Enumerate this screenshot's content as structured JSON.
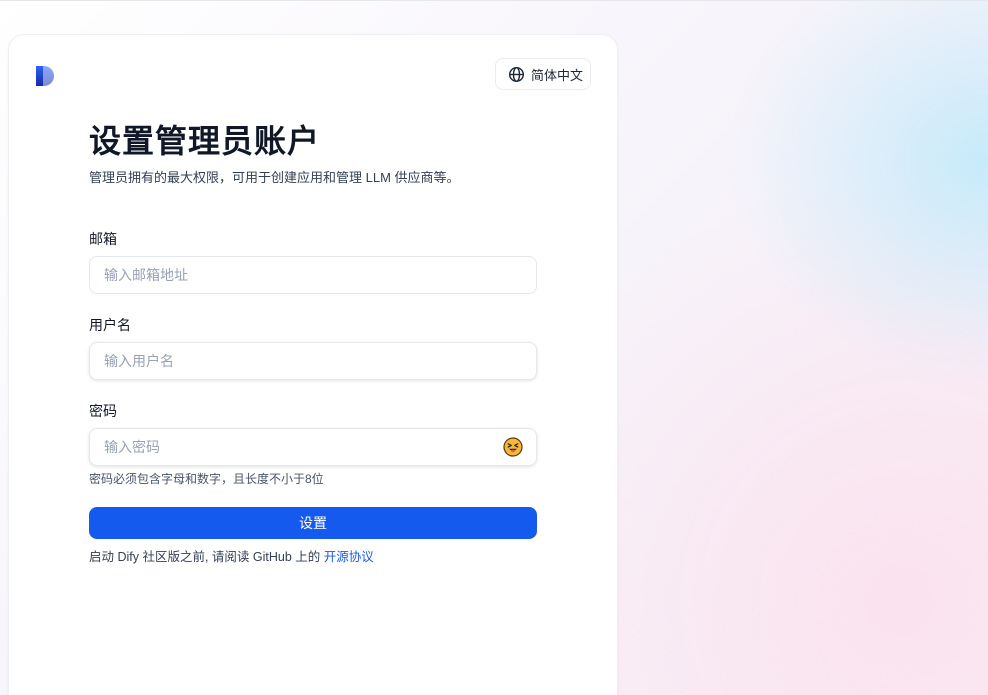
{
  "language": {
    "label": "简体中文",
    "icon": "globe-icon"
  },
  "logo": {
    "icon": "dify-logo",
    "color_top": "#1b3de0",
    "color_bottom": "#1528a8"
  },
  "header": {
    "title": "设置管理员账户",
    "subtitle": "管理员拥有的最大权限，可用于创建应用和管理 LLM 供应商等。"
  },
  "form": {
    "email": {
      "label": "邮箱",
      "placeholder": "输入邮箱地址",
      "value": ""
    },
    "username": {
      "label": "用户名",
      "placeholder": "输入用户名",
      "value": ""
    },
    "password": {
      "label": "密码",
      "placeholder": "输入密码",
      "value": "",
      "toggle_icon": "eye-closed-emoji-icon",
      "hint": "密码必须包含字母和数字，且长度不小于8位"
    },
    "submit_label": "设置"
  },
  "license": {
    "text": "启动 Dify 社区版之前, 请阅读 GitHub 上的",
    "link_label": "开源协议"
  },
  "colors": {
    "accent": "#155aef",
    "text": "#101828",
    "muted": "#98a2b3"
  }
}
